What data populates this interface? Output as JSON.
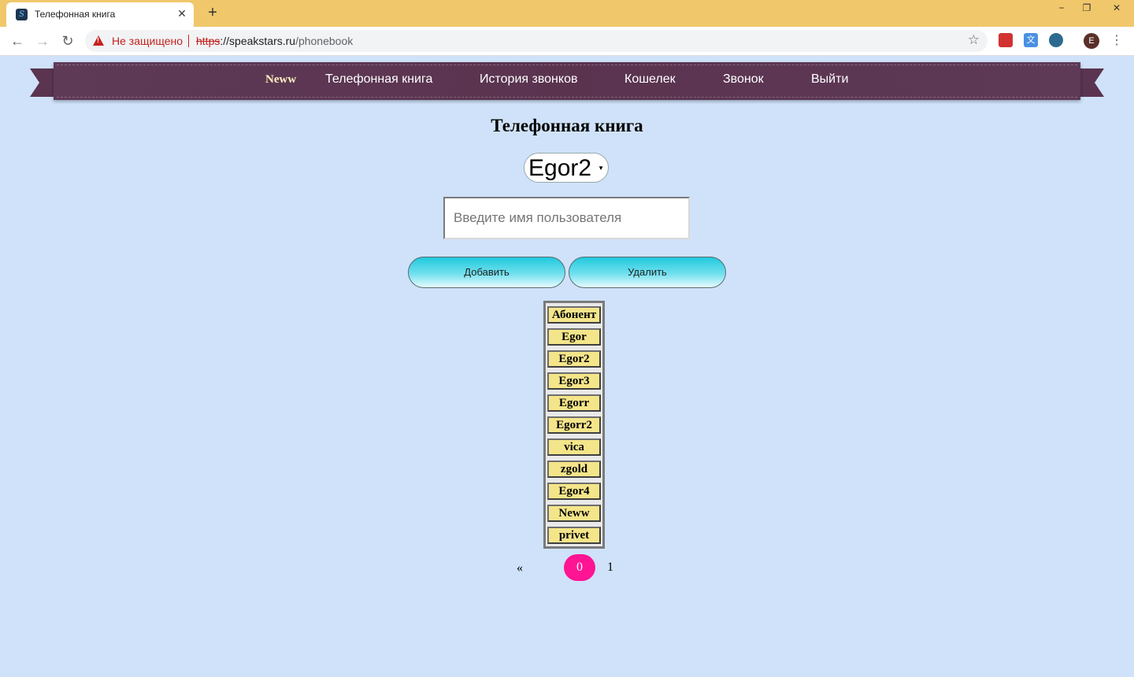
{
  "browser": {
    "tab_title": "Телефонная книга",
    "tab_close": "✕",
    "new_tab": "+",
    "window_minimize": "−",
    "window_restore": "❐",
    "window_close": "✕",
    "security_text": "Не защищено",
    "url_scheme": "https",
    "url_host": "://speakstars.ru",
    "url_path": "/phonebook",
    "avatar_letter": "E"
  },
  "navbar": {
    "current_user": "Neww",
    "links": [
      "Телефонная книга",
      "История звонков",
      "Кошелек",
      "Звонок",
      "Выйти"
    ]
  },
  "page": {
    "title": "Телефонная книга",
    "selected_user": "Egor2",
    "username_placeholder": "Введите имя пользователя",
    "add_button": "Добавить",
    "delete_button": "Удалить"
  },
  "contacts": {
    "header": "Абонент",
    "rows": [
      "Egor",
      "Egor2",
      "Egor3",
      "Egorr",
      "Egorr2",
      "vica",
      "zgold",
      "Egor4",
      "Neww",
      "privet"
    ]
  },
  "pagination": {
    "prev": "«",
    "current": "0",
    "next": "1"
  },
  "colors": {
    "page_bg": "#cfe2fa",
    "navbar_bg": "#5a334f",
    "button_cyan": "#1fc9dd",
    "cell_yellow": "#f4e58a",
    "active_page": "#ff1493"
  }
}
